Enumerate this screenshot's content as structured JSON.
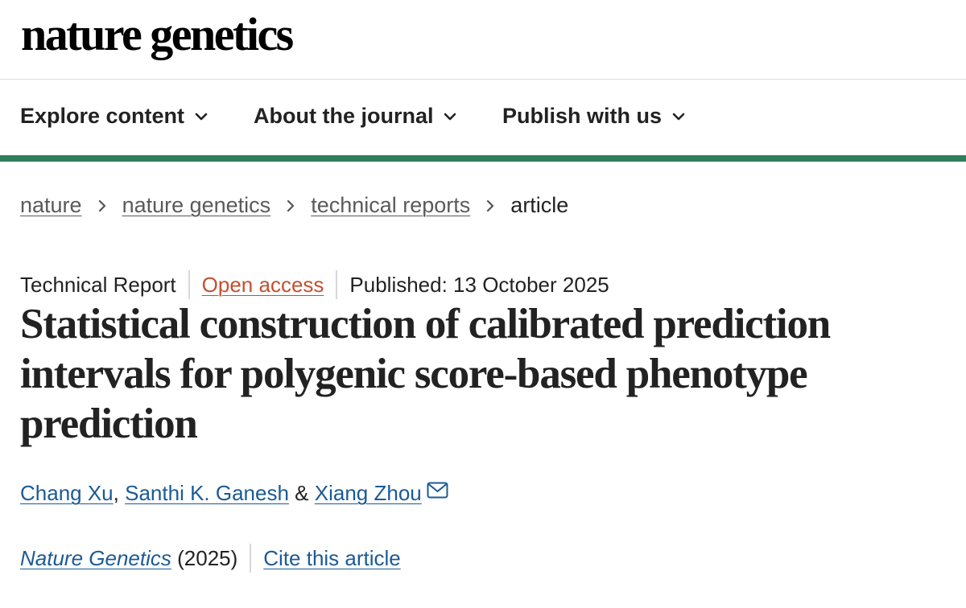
{
  "header": {
    "logo_text": "nature genetics"
  },
  "nav": {
    "items": [
      {
        "label": "Explore content",
        "icon": "chevron-down-icon"
      },
      {
        "label": "About the journal",
        "icon": "chevron-down-icon"
      },
      {
        "label": "Publish with us",
        "icon": "chevron-down-icon"
      }
    ]
  },
  "breadcrumb": {
    "items": [
      "nature",
      "nature genetics",
      "technical reports"
    ],
    "current": "article"
  },
  "article": {
    "type": "Technical Report",
    "access": "Open access",
    "published": "Published: 13 October 2025",
    "title": "Statistical construction of calibrated prediction intervals for polygenic score-based phenotype prediction",
    "authors": [
      "Chang Xu",
      "Santhi K. Ganesh",
      "Xiang Zhou"
    ],
    "author_sep_1": ",",
    "author_sep_2": "&",
    "journal": "Nature Genetics",
    "year": "(2025)",
    "cite_label": "Cite this article"
  },
  "colors": {
    "accent_green": "#2f7f5b",
    "open_access": "#c4502e",
    "link_blue": "#1a5a96"
  }
}
